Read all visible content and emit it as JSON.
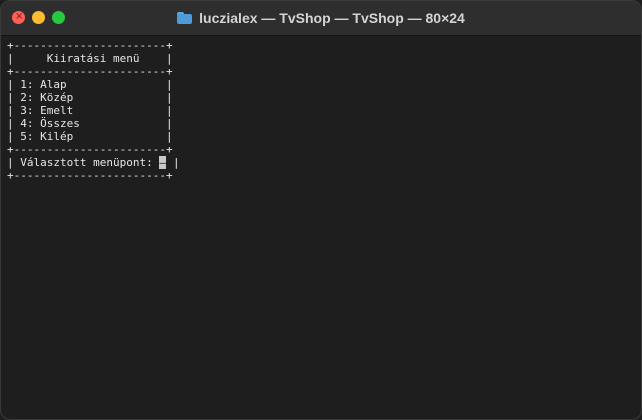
{
  "window": {
    "title": "luczialex — TvShop — TvShop — 80×24",
    "folder_icon": "folder-icon"
  },
  "terminal": {
    "lines": [
      "+-----------------------+",
      "|     Kiiratási menü    |",
      "+-----------------------+",
      "| 1: Alap               |",
      "| 2: Közép              |",
      "| 3: Emelt              |",
      "| 4: Összes             |",
      "| 5: Kilép              |",
      "+-----------------------+",
      "| Választott menüpont: ",
      "+-----------------------+"
    ],
    "prompt_cursor": "–",
    "prompt_suffix": " |"
  },
  "colors": {
    "close": "#fe5f57",
    "minimize": "#febc2e",
    "maximize": "#28c840",
    "background": "#1e1e1e",
    "text": "#e6e6e6"
  }
}
